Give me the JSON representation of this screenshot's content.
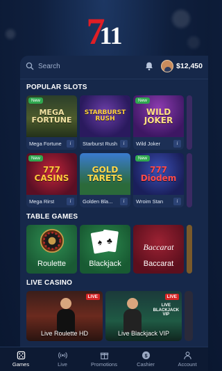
{
  "brand": {
    "logo_seven": "7",
    "logo_eleven": "11"
  },
  "header": {
    "search_placeholder": "Search",
    "balance": "$12,450"
  },
  "sections": {
    "popular_slots": "POPULAR SLOTS",
    "table_games": "TABLE GAMES",
    "live_casino": "LIVE CASINO"
  },
  "slots": [
    {
      "art": "MEGA\nFORTUNE",
      "name": "Mega Fortune",
      "new": "New",
      "info": "i"
    },
    {
      "art": "STARBURST\nRUSH",
      "name": "Starburst Rush",
      "new": "",
      "info": "i"
    },
    {
      "art": "WILD\nJOKER",
      "name": "Wild Joker",
      "new": "New",
      "info": "i"
    },
    {
      "art": "777\nCASINS",
      "name": "Mega Rirst",
      "new": "New",
      "info": "i"
    },
    {
      "art": "GOLD\nTARETS",
      "name": "Golden Bla...",
      "new": "",
      "info": "i"
    },
    {
      "art": "777\nDiodem",
      "name": "Wroim Stan",
      "new": "New",
      "info": "i"
    }
  ],
  "tables": [
    {
      "name": "Roulette"
    },
    {
      "name": "Blackjack"
    },
    {
      "name": "Baccarat",
      "art": "Baccarat"
    }
  ],
  "live": [
    {
      "name": "Live Roulette HD",
      "badge": "LIVE"
    },
    {
      "name": "Live Blackjack VIP",
      "badge": "LIVE",
      "sub": "LIVE\nBLACKJACK\nVIP"
    }
  ],
  "nav": [
    {
      "label": "Games",
      "icon": "dice-icon",
      "active": true
    },
    {
      "label": "Live",
      "icon": "broadcast-icon",
      "active": false
    },
    {
      "label": "Promotions",
      "icon": "gift-icon",
      "active": false
    },
    {
      "label": "Cashier",
      "icon": "dollar-coin-icon",
      "active": false
    },
    {
      "label": "Account",
      "icon": "person-icon",
      "active": false
    }
  ],
  "colors": {
    "accent_red": "#e01e25",
    "badge_green": "#2fa84f",
    "panel": "#16284a"
  }
}
